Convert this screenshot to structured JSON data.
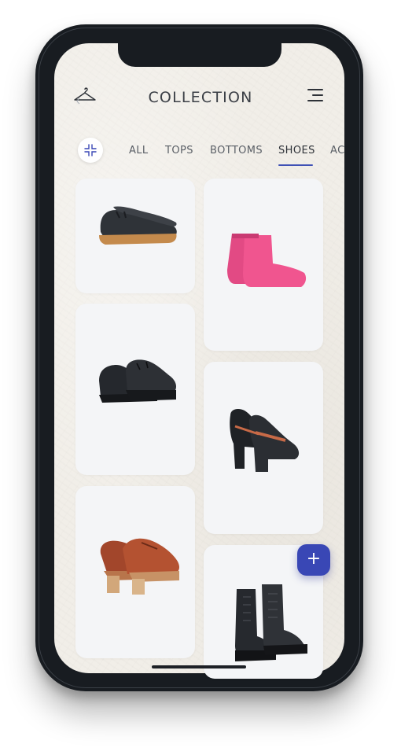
{
  "header": {
    "title": "COLLECTION",
    "left_icon": "hanger-icon",
    "right_icon": "menu-icon"
  },
  "filter": {
    "icon": "collapse-icon"
  },
  "tabs": [
    {
      "label": "ALL",
      "active": false
    },
    {
      "label": "TOPS",
      "active": false
    },
    {
      "label": "BOTTOMS",
      "active": false
    },
    {
      "label": "SHOES",
      "active": true
    },
    {
      "label": "AC",
      "active": false
    }
  ],
  "items": [
    {
      "name": "black slip-on platform shoe",
      "column": "left"
    },
    {
      "name": "pink rubber ankle boots",
      "column": "right"
    },
    {
      "name": "black lace-up derby shoes",
      "column": "left"
    },
    {
      "name": "black patent mary-jane heels",
      "column": "right"
    },
    {
      "name": "tan leather platform loafers",
      "column": "left"
    },
    {
      "name": "black lace-up combat boots",
      "column": "right"
    }
  ],
  "fab": {
    "label": "+"
  },
  "colors": {
    "accent": "#3947b5",
    "background": "#f1eee8",
    "card": "#f4f5f7",
    "phone_frame": "#181c21"
  }
}
